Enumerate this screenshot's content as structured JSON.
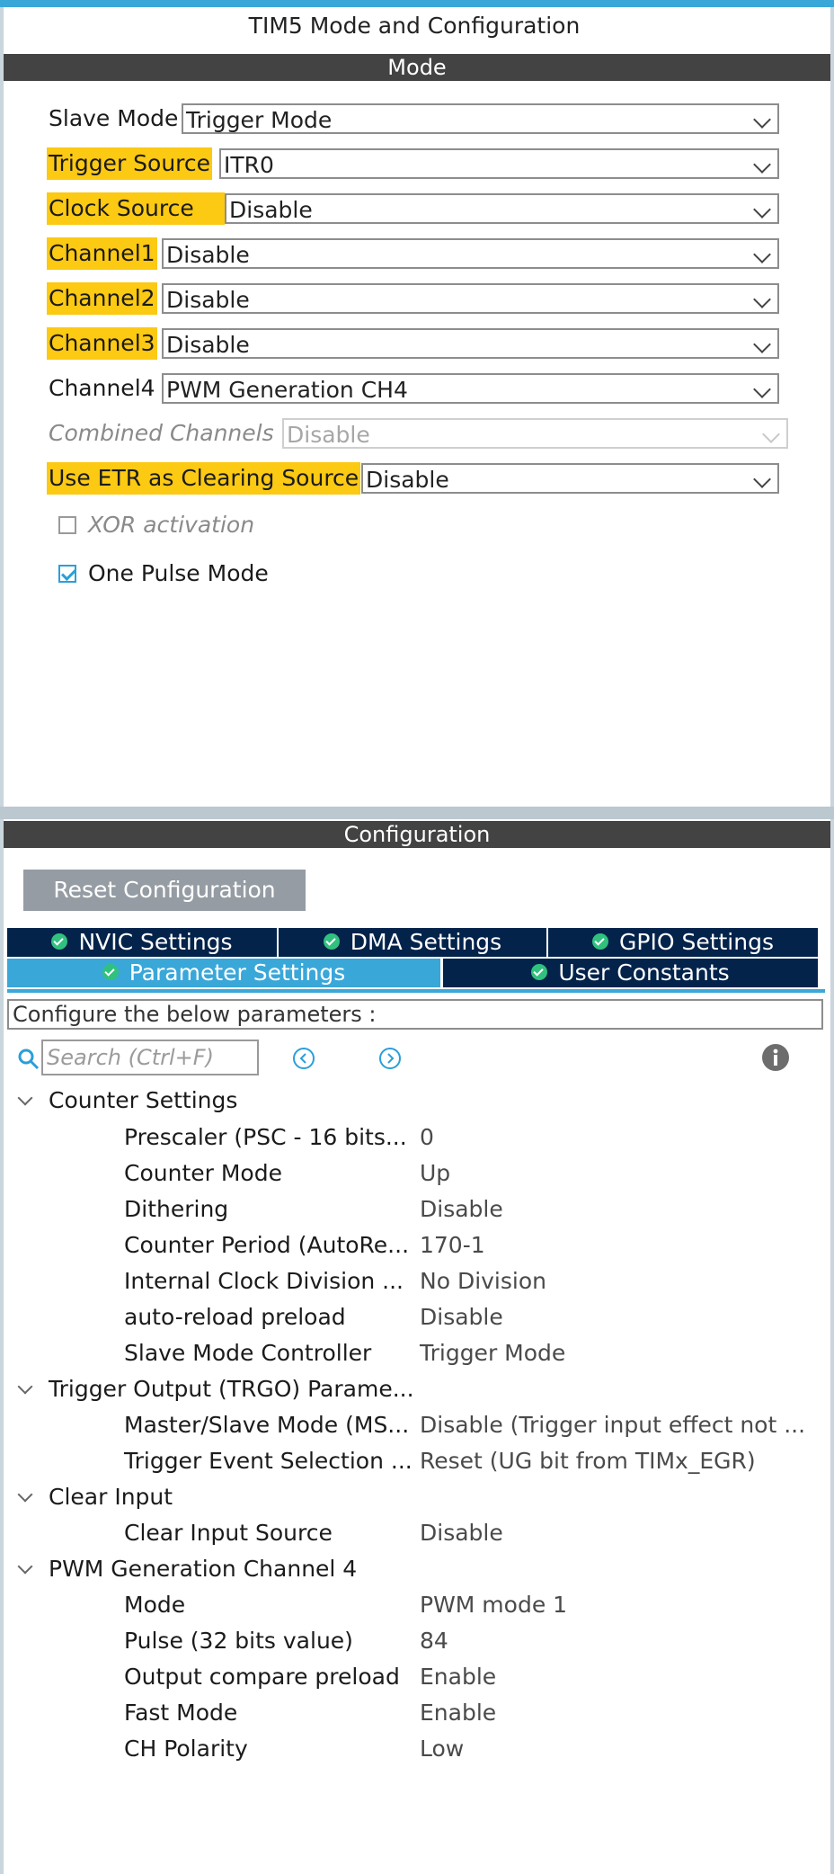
{
  "window": {
    "title": "TIM5 Mode and Configuration"
  },
  "mode": {
    "header": "Mode",
    "fields": [
      {
        "label": "Slave Mode",
        "value": "Trigger Mode"
      },
      {
        "label": "Trigger Source",
        "value": "ITR0"
      },
      {
        "label": "Clock Source",
        "value": "Disable"
      },
      {
        "label": "Channel1",
        "value": "Disable"
      },
      {
        "label": "Channel2",
        "value": "Disable"
      },
      {
        "label": "Channel3",
        "value": "Disable"
      },
      {
        "label": "Channel4",
        "value": "PWM Generation CH4"
      },
      {
        "label": "Combined Channels",
        "value": "Disable"
      },
      {
        "label": "Use ETR as Clearing Source",
        "value": "Disable"
      }
    ],
    "checkboxes": [
      {
        "label": "XOR activation",
        "checked": false
      },
      {
        "label": "One Pulse Mode",
        "checked": true
      }
    ]
  },
  "configuration": {
    "header": "Configuration",
    "reset_label": "Reset Configuration",
    "tabs": [
      {
        "label": "NVIC Settings"
      },
      {
        "label": "DMA Settings"
      },
      {
        "label": "GPIO Settings"
      },
      {
        "label": "Parameter Settings"
      },
      {
        "label": "User Constants"
      }
    ],
    "description": "Configure the below parameters :",
    "search_placeholder": "Search (Ctrl+F)",
    "groups": [
      {
        "label": "Counter Settings",
        "params": [
          {
            "name": "Prescaler (PSC - 16 bits...",
            "value": "0"
          },
          {
            "name": "Counter Mode",
            "value": "Up"
          },
          {
            "name": "Dithering",
            "value": "Disable"
          },
          {
            "name": "Counter Period (AutoRe...",
            "value": "170-1"
          },
          {
            "name": "Internal Clock Division ...",
            "value": "No Division"
          },
          {
            "name": "auto-reload preload",
            "value": "Disable"
          },
          {
            "name": "Slave Mode Controller",
            "value": "Trigger Mode"
          }
        ]
      },
      {
        "label": "Trigger Output (TRGO) Parame...",
        "params": [
          {
            "name": "Master/Slave Mode (MS...",
            "value": "Disable (Trigger input effect not ..."
          },
          {
            "name": "Trigger Event Selection ...",
            "value": "Reset (UG bit from TIMx_EGR)"
          }
        ]
      },
      {
        "label": "Clear Input",
        "params": [
          {
            "name": "Clear Input Source",
            "value": "Disable"
          }
        ]
      },
      {
        "label": "PWM Generation Channel 4",
        "params": [
          {
            "name": "Mode",
            "value": "PWM mode 1"
          },
          {
            "name": "Pulse (32 bits value)",
            "value": "84"
          },
          {
            "name": "Output compare preload",
            "value": "Enable"
          },
          {
            "name": "Fast Mode",
            "value": "Enable"
          },
          {
            "name": "CH Polarity",
            "value": "Low"
          }
        ]
      }
    ]
  },
  "colors": {
    "accent": "#3aa7d9",
    "highlight": "#fcc913",
    "tab_bg": "#03234b",
    "ok_green": "#31c17e"
  }
}
